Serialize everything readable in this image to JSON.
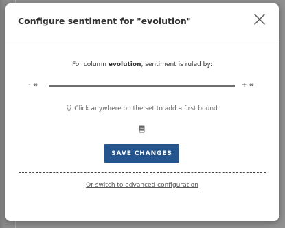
{
  "dialog": {
    "title": "Configure sentiment for \"evolution\"",
    "close_icon": "close-icon"
  },
  "rule": {
    "prefix": "For column ",
    "column": "evolution",
    "suffix": ", sentiment is ruled by:"
  },
  "range": {
    "lower_label": "- ∞",
    "upper_label": "+ ∞"
  },
  "hint": {
    "icon": "lightbulb-icon",
    "text": "Click anywhere on the set to add a first bound"
  },
  "book_icon": "book-icon",
  "actions": {
    "save_label": "SAVE CHANGES",
    "advanced_link": "Or switch to advanced configuration"
  },
  "colors": {
    "primary": "#24558f",
    "bar": "#6e6e6e"
  }
}
